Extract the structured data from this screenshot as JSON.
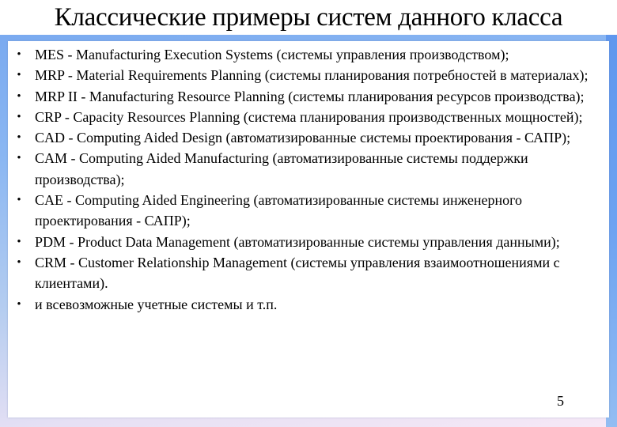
{
  "slide": {
    "title": "Классические примеры систем данного класса",
    "page_number": "5",
    "colors": {
      "frame_blue": "#7aaaf0",
      "frame_right_blue": "#5f97ee",
      "frame_pink": "#f6e8f6",
      "panel": "#ffffff",
      "text": "#000000"
    },
    "bullet_icon": "bullet-dot",
    "items": [
      {
        "text": "MES - Manufacturing Execution Systems (системы управления производством);"
      },
      {
        "text": "MRP - Material Requirements Planning (системы планирования потребностей в материалах);"
      },
      {
        "text": "MRP II - Manufacturing Resource Planning (системы планирования ресурсов производства);"
      },
      {
        "text": "CRP - Capacity Resources Planning (система планирования производственных мощностей);"
      },
      {
        "text": "CAD - Computing Aided Design (автоматизированные системы проектирования - САПР);"
      },
      {
        "text": "CAM - Computing Aided Manufacturing (автоматизированные системы поддержки производства);"
      },
      {
        "text": "CAE - Computing Aided Engineering (автоматизированные системы инженерного проектирования - САПР);"
      },
      {
        "text": "PDM - Product Data Management (автоматизированные системы управления данными);"
      },
      {
        "text": "CRM - Customer Relationship Management (системы управления взаимоотношениями с клиентами)."
      },
      {
        "text": "и всевозможные учетные системы и т.п."
      }
    ]
  }
}
